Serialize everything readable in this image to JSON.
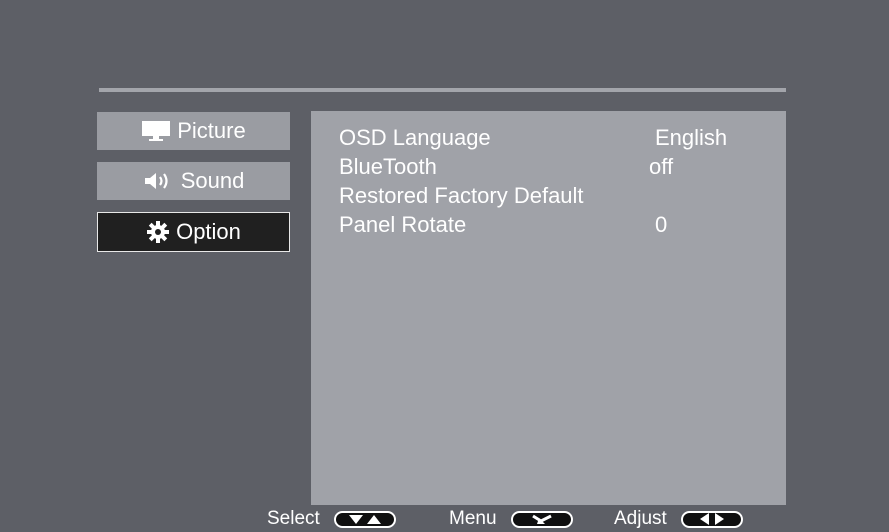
{
  "menu": {
    "tabs": [
      {
        "label": "Picture",
        "icon": "monitor-icon"
      },
      {
        "label": "Sound",
        "icon": "speaker-icon"
      },
      {
        "label": "Option",
        "icon": "gear-icon",
        "active": true
      }
    ]
  },
  "options": [
    {
      "label": "OSD Language",
      "value": "English"
    },
    {
      "label": "BlueTooth",
      "value": "off"
    },
    {
      "label": "Restored Factory Default",
      "value": ""
    },
    {
      "label": "Panel Rotate",
      "value": "0"
    }
  ],
  "footer": {
    "select_label": "Select",
    "select_icon": "up-down-arrows-icon",
    "menu_label": "Menu",
    "menu_icon": "return-arrow-icon",
    "adjust_label": "Adjust",
    "adjust_icon": "left-right-arrows-icon"
  },
  "colors": {
    "background": "#5d5f66",
    "panel": "#a0a2a8",
    "tab": "#9a9ca2",
    "tab_active": "#202020",
    "text": "#ffffff"
  }
}
